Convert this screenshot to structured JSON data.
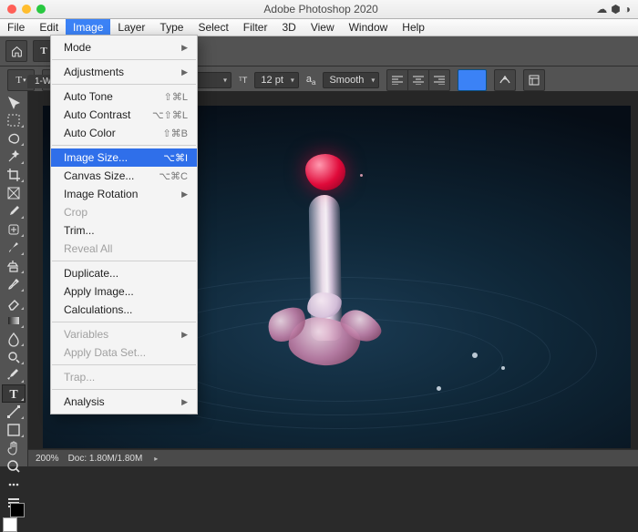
{
  "app_title": "Adobe Photoshop 2020",
  "menubar": [
    "File",
    "Edit",
    "Image",
    "Layer",
    "Type",
    "Select",
    "Filter",
    "3D",
    "View",
    "Window",
    "Help"
  ],
  "menubar_open_index": 2,
  "image_menu": {
    "groups": [
      [
        {
          "label": "Mode",
          "submenu": true
        }
      ],
      [
        {
          "label": "Adjustments",
          "submenu": true
        }
      ],
      [
        {
          "label": "Auto Tone",
          "shortcut": "⇧⌘L"
        },
        {
          "label": "Auto Contrast",
          "shortcut": "⌥⇧⌘L"
        },
        {
          "label": "Auto Color",
          "shortcut": "⇧⌘B"
        }
      ],
      [
        {
          "label": "Image Size...",
          "shortcut": "⌥⌘I",
          "selected": true
        },
        {
          "label": "Canvas Size...",
          "shortcut": "⌥⌘C"
        },
        {
          "label": "Image Rotation",
          "submenu": true
        },
        {
          "label": "Crop",
          "disabled": true
        },
        {
          "label": "Trim..."
        },
        {
          "label": "Reveal All",
          "disabled": true
        }
      ],
      [
        {
          "label": "Duplicate..."
        },
        {
          "label": "Apply Image..."
        },
        {
          "label": "Calculations..."
        }
      ],
      [
        {
          "label": "Variables",
          "submenu": true,
          "disabled": true
        },
        {
          "label": "Apply Data Set...",
          "disabled": true
        }
      ],
      [
        {
          "label": "Trap...",
          "disabled": true
        }
      ],
      [
        {
          "label": "Analysis",
          "submenu": true
        }
      ]
    ]
  },
  "options_bar": {
    "font_size_value": "12 pt",
    "aa_label": "a",
    "aa_sub": "a",
    "aa_method": "Smooth",
    "align_icons": [
      "align-left-icon",
      "align-center-icon",
      "align-right-icon"
    ],
    "color_swatch": "#3b82f6"
  },
  "document_tab": "1-W…",
  "status": {
    "zoom": "200%",
    "doc_info": "Doc: 1.80M/1.80M"
  },
  "tool_icons": [
    "move",
    "marquee",
    "lasso",
    "wand",
    "crop",
    "frame",
    "eyedropper",
    "heal",
    "brush",
    "clone",
    "history",
    "eraser",
    "gradient",
    "blur",
    "dodge",
    "pen",
    "type",
    "path",
    "shape",
    "hand",
    "zoom",
    "more",
    "edit-tools"
  ],
  "selected_tool_index": 16
}
